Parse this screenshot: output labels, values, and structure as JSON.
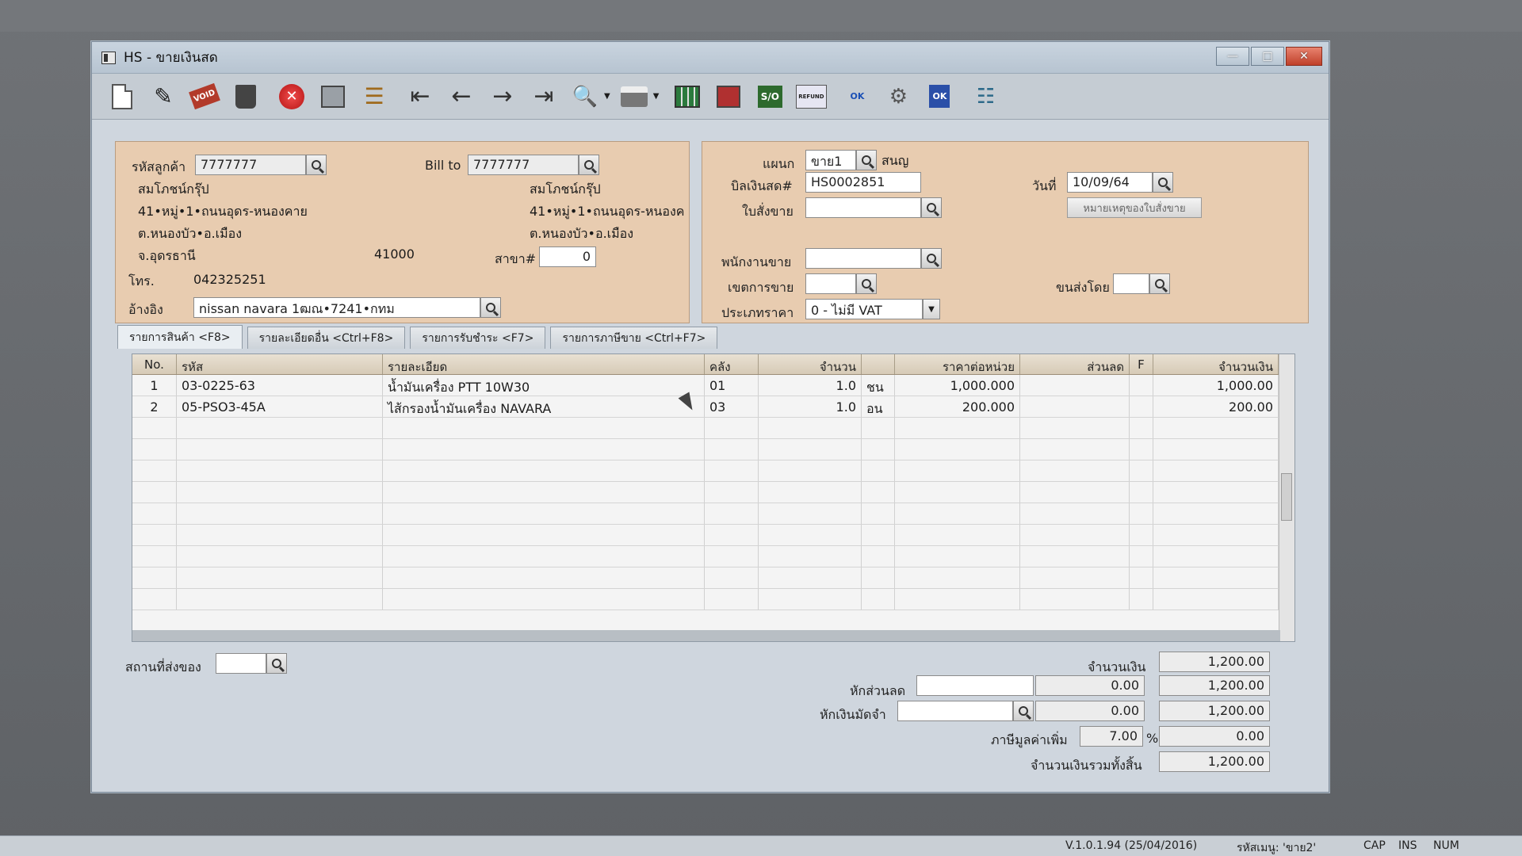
{
  "window": {
    "title": "HS - ขายเงินสด",
    "min_icon": "minimize-icon",
    "max_icon": "maximize-icon",
    "close_icon": "close-icon"
  },
  "toolbar": {
    "icons": [
      "new-document-icon",
      "edit-icon",
      "void-icon",
      "delete-icon",
      "cancel-icon",
      "save-icon",
      "copy-icon",
      "first-record-icon",
      "previous-record-icon",
      "next-record-icon",
      "last-record-icon",
      "search-document-icon",
      "print-icon",
      "export-icon",
      "report-icon",
      "sales-order-icon",
      "refund-icon",
      "approve-icon",
      "tools-icon",
      "ok-icon",
      "settings-icon"
    ],
    "void_label": "VOID",
    "so_label": "S/O",
    "ok_label": "OK",
    "refund_label": "REFUND"
  },
  "customer": {
    "code_label": "รหัสลูกค้า",
    "code": "7777777",
    "name": "สมโภชน์กรุ๊ป",
    "address1": "41•หมู่•1•ถนนอุดร-หนองคาย",
    "address2": "ต.หนองบัว•อ.เมือง",
    "province": "จ.อุดรธานี",
    "zip": "41000",
    "phone_label": "โทร.",
    "phone": "042325251",
    "ref_label": "อ้างอิง",
    "ref": "nissan navara 1ฒณ•7241•กทม",
    "branch_label": "สาขา#",
    "branch": "0"
  },
  "bill_to": {
    "label": "Bill to",
    "code": "7777777",
    "name": "สมโภชน์กรุ๊ป",
    "address1": "41•หมู่•1•ถนนอุดร-หนองค",
    "address2": "ต.หนองบัว•อ.เมือง"
  },
  "doc": {
    "dept_label": "แผนก",
    "dept": "ขาย1",
    "dept_name": "สนญ",
    "cashbill_label": "บิลเงินสด#",
    "cashbill": "HS0002851",
    "date_label": "วันที่",
    "date": "10/09/64",
    "so_label": "ใบสั่งขาย",
    "so": "",
    "so_note_button": "หมายเหตุของใบสั่งขาย",
    "salesman_label": "พนักงานขาย",
    "salesman": "",
    "zone_label": "เขตการขาย",
    "zone": "",
    "shipby_label": "ขนส่งโดย",
    "shipby": "",
    "pricetype_label": "ประเภทราคา",
    "pricetype": "0 - ไม่มี VAT"
  },
  "tabs": [
    {
      "label": "รายการสินค้า <F8>"
    },
    {
      "label": "รายละเอียดอื่น <Ctrl+F8>"
    },
    {
      "label": "รายการรับชำระ <F7>"
    },
    {
      "label": "รายการภาษีขาย <Ctrl+F7>"
    }
  ],
  "grid": {
    "headers": {
      "no": "No.",
      "code": "รหัส",
      "desc": "รายละเอียด",
      "wh": "คลัง",
      "qty": "จำนวน",
      "unit": "",
      "price": "ราคาต่อหน่วย",
      "disc": "ส่วนลด",
      "f": "F",
      "amt": "จำนวนเงิน"
    },
    "rows": [
      {
        "no": "1",
        "code": "03-0225-63",
        "desc": "น้ำมันเครื่อง PTT 10W30",
        "wh": "01",
        "qty": "1.0",
        "unit": "ชน",
        "price": "1,000.000",
        "disc": "",
        "f": "",
        "amt": "1,000.00"
      },
      {
        "no": "2",
        "code": "05-PSO3-45A",
        "desc": "ไส้กรองน้ำมันเครื่อง NAVARA",
        "wh": "03",
        "qty": "1.0",
        "unit": "อน",
        "price": "200.000",
        "disc": "",
        "f": "",
        "amt": "200.00"
      }
    ]
  },
  "summary": {
    "ship_place_label": "สถานที่ส่งของ",
    "ship_place": "",
    "amount_label": "จำนวนเงิน",
    "amount": "1,200.00",
    "discount_label": "หักส่วนลด",
    "discount_text": "",
    "discount_value": "0.00",
    "after_discount": "1,200.00",
    "deposit_label": "หักเงินมัดจำ",
    "deposit_code": "",
    "deposit_value": "0.00",
    "after_deposit": "1,200.00",
    "vat_label": "ภาษีมูลค่าเพิ่ม",
    "vat_rate": "7.00",
    "vat_percent": "%",
    "vat_amount": "0.00",
    "total_label": "จำนวนเงินรวมทั้งสิ้น",
    "total": "1,200.00"
  },
  "statusbar": {
    "version": "V.1.0.1.94 (25/04/2016)",
    "menu_code": "รหัสเมนู: 'ขาย2'",
    "cap": "CAP",
    "ins": "INS",
    "num": "NUM"
  }
}
